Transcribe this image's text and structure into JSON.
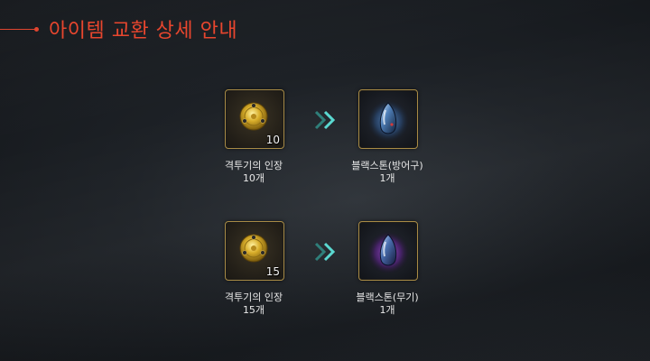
{
  "header": {
    "title": "아이템 교환 상세 안내"
  },
  "exchanges": [
    {
      "source": {
        "icon": "medal-icon",
        "count_badge": "10",
        "name": "격투기의 인장",
        "quantity": "10개"
      },
      "arrow_icon": "double-chevron-right-icon",
      "result": {
        "icon": "blackstone-armor-icon",
        "name": "블랙스톤(방어구)",
        "quantity": "1개"
      }
    },
    {
      "source": {
        "icon": "medal-icon",
        "count_badge": "15",
        "name": "격투기의 인장",
        "quantity": "15개"
      },
      "arrow_icon": "double-chevron-right-icon",
      "result": {
        "icon": "blackstone-weapon-icon",
        "name": "블랙스톤(무기)",
        "quantity": "1개"
      }
    }
  ],
  "colors": {
    "accent": "#e8462e",
    "slot_border": "#a88b45",
    "arrow": "#5ad8d0",
    "armor_glow": "#3f7fc4",
    "weapon_glow": "#a23fd0"
  }
}
